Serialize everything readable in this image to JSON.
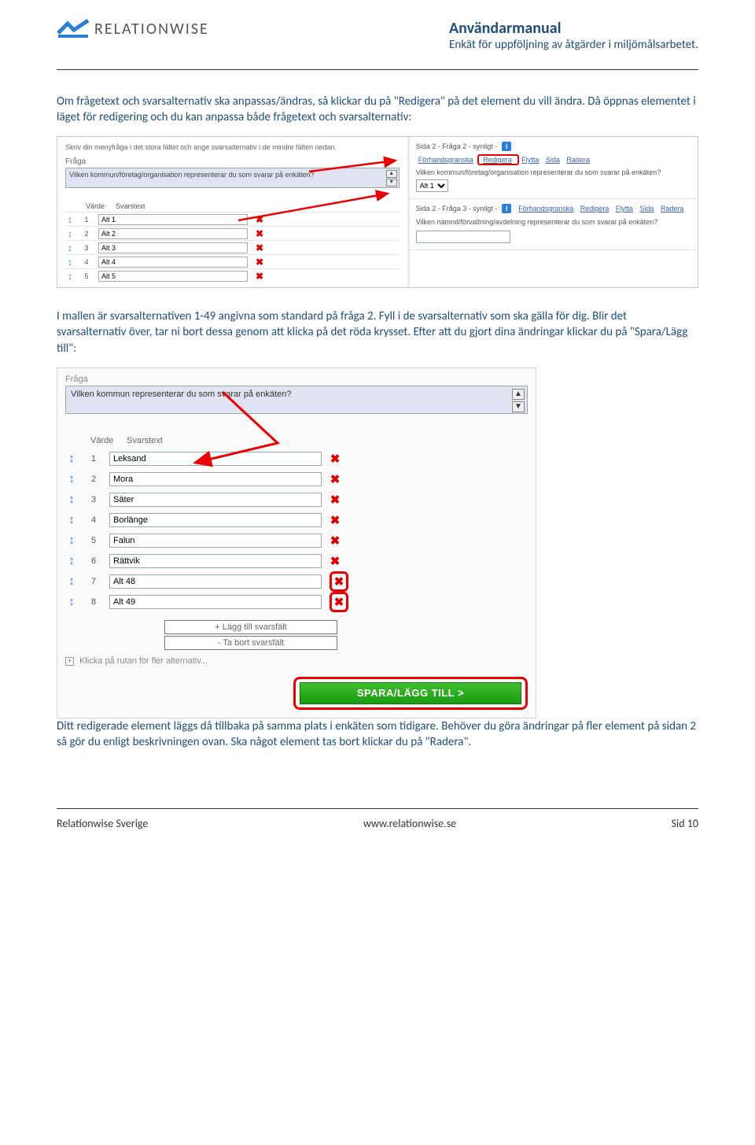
{
  "header": {
    "brand": "RELATIONWISE",
    "title": "Användarmanual",
    "subtitle": "Enkät för uppföljning av åtgärder i miljömålsarbetet."
  },
  "body": {
    "p1": "Om frågetext och svarsalternativ ska anpassas/ändras, så klickar du på \"Redigera\" på det element du vill ändra. Då öppnas elementet i läget för redigering och du kan anpassa både frågetext och svarsalternativ:",
    "p2": "I mallen är svarsalternativen 1-49 angivna som standard på fråga 2. Fyll i de svarsalternativ som ska gälla för dig. Blir det svarsalternativ över, tar ni bort dessa genom att klicka på det röda krysset. Efter att du gjort dina ändringar klickar du på \"Spara/Lägg till\":",
    "p3": "Ditt redigerade element läggs då tillbaka på samma plats i enkäten som tidigare. Behöver du göra ändringar på fler element på sidan 2 så gör du enligt beskrivningen ovan. Ska något element tas bort klickar du på \"Radera\"."
  },
  "shot1": {
    "instr": "Skriv din menyfråga i det stora fältet och ange svarsalternativ i de mindre fälten nedan.",
    "label_fraga": "Fråga",
    "question": "Vilken kommun/företag/organisation representerar du som svarar på enkäten?",
    "col_varde": "Värde",
    "col_svarstext": "Svarstext",
    "rows": [
      {
        "n": "1",
        "t": "Alt 1"
      },
      {
        "n": "2",
        "t": "Alt 2"
      },
      {
        "n": "3",
        "t": "Alt 3"
      },
      {
        "n": "4",
        "t": "Alt 4"
      },
      {
        "n": "5",
        "t": "Alt 5"
      }
    ],
    "right": {
      "b1_head": "Sida 2 - Fråga 2 - synligt -",
      "links": {
        "l1": "Förhandsgranska",
        "l2": "Redigera",
        "l3": "Flytta",
        "l4": "Sida",
        "l5": "Radera"
      },
      "b1_q": "Vilken kommun/företag/organisation representerar du som svarar på enkäten?",
      "alt1": "Alt 1",
      "b2_head": "Sida 2 - Fråga 3 - synligt -",
      "b2_q": "Vilken nämnd/förvaltning/avdelning representerar du som svarar på enkäten?"
    }
  },
  "shot2": {
    "label_fraga": "Fråga",
    "question": "Vilken kommun representerar du som svarar på enkäten?",
    "col_varde": "Värde",
    "col_svarstext": "Svarstext",
    "rows": [
      {
        "n": "1",
        "t": "Leksand"
      },
      {
        "n": "2",
        "t": "Mora"
      },
      {
        "n": "3",
        "t": "Säter"
      },
      {
        "n": "4",
        "t": "Borlänge"
      },
      {
        "n": "5",
        "t": "Falun"
      },
      {
        "n": "6",
        "t": "Rättvik"
      },
      {
        "n": "7",
        "t": "Alt 48"
      },
      {
        "n": "8",
        "t": "Alt 49"
      }
    ],
    "btn_add": "+ Lägg till svarsfält",
    "btn_rem": "- Ta bort svarsfält",
    "expand": "Klicka på rutan för fler alternativ...",
    "save": "SPARA/LÄGG TILL >"
  },
  "footer": {
    "left": "Relationwise Sverige",
    "center": "www.relationwise.se",
    "right": "Sid 10"
  }
}
